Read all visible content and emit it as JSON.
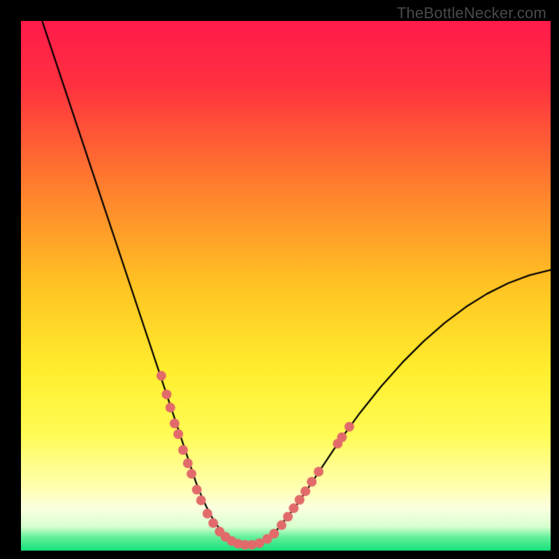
{
  "watermark": "TheBottleNecker.com",
  "chart_data": {
    "type": "line",
    "title": "",
    "xlabel": "",
    "ylabel": "",
    "xlim": [
      0,
      100
    ],
    "ylim": [
      0,
      100
    ],
    "background_gradient": [
      {
        "stop": 0.0,
        "color": "#ff1b4b"
      },
      {
        "stop": 0.12,
        "color": "#ff3140"
      },
      {
        "stop": 0.3,
        "color": "#ff7a2f"
      },
      {
        "stop": 0.5,
        "color": "#ffc423"
      },
      {
        "stop": 0.66,
        "color": "#ffee2e"
      },
      {
        "stop": 0.78,
        "color": "#fffc55"
      },
      {
        "stop": 0.88,
        "color": "#ffffb0"
      },
      {
        "stop": 0.92,
        "color": "#fbffe0"
      },
      {
        "stop": 0.955,
        "color": "#d7ffcf"
      },
      {
        "stop": 0.975,
        "color": "#62f09a"
      },
      {
        "stop": 1.0,
        "color": "#17e07c"
      }
    ],
    "series": [
      {
        "name": "bottleneck-curve",
        "color": "#000000",
        "width": 2.3,
        "x": [
          4,
          6,
          8,
          10,
          12,
          14,
          16,
          18,
          20,
          22,
          24,
          26,
          28,
          30,
          32,
          33,
          34,
          35,
          36,
          37,
          38,
          39,
          40,
          41,
          42,
          43,
          45,
          48,
          52,
          56,
          60,
          64,
          68,
          72,
          76,
          80,
          84,
          88,
          92,
          96,
          100
        ],
        "y": [
          100,
          94,
          88,
          82,
          76,
          70,
          64,
          58,
          52,
          46,
          40,
          34,
          28,
          22,
          16,
          13,
          10.5,
          8.3,
          6.4,
          4.8,
          3.5,
          2.5,
          1.8,
          1.3,
          1.0,
          1.0,
          1.3,
          3.5,
          8.5,
          14.5,
          20.5,
          26.0,
          31.0,
          35.5,
          39.5,
          43.0,
          46.0,
          48.5,
          50.5,
          52.0,
          53.0
        ]
      }
    ],
    "scatter": [
      {
        "name": "sample-points-left",
        "color": "#e26a6a",
        "radius": 7,
        "points": [
          {
            "x": 26.5,
            "y": 33.0
          },
          {
            "x": 27.5,
            "y": 29.5
          },
          {
            "x": 28.2,
            "y": 27.0
          },
          {
            "x": 29.0,
            "y": 24.0
          },
          {
            "x": 29.7,
            "y": 22.0
          },
          {
            "x": 30.6,
            "y": 19.0
          },
          {
            "x": 31.5,
            "y": 16.5
          },
          {
            "x": 32.2,
            "y": 14.5
          },
          {
            "x": 33.2,
            "y": 11.5
          },
          {
            "x": 34.0,
            "y": 9.5
          },
          {
            "x": 35.2,
            "y": 7.0
          },
          {
            "x": 36.3,
            "y": 5.2
          }
        ]
      },
      {
        "name": "sample-points-bottom",
        "color": "#e26a6a",
        "radius": 7,
        "points": [
          {
            "x": 37.5,
            "y": 3.6
          },
          {
            "x": 38.6,
            "y": 2.6
          },
          {
            "x": 39.8,
            "y": 1.8
          },
          {
            "x": 41.0,
            "y": 1.3
          },
          {
            "x": 42.3,
            "y": 1.1
          },
          {
            "x": 43.6,
            "y": 1.1
          },
          {
            "x": 45.0,
            "y": 1.4
          },
          {
            "x": 46.5,
            "y": 2.2
          },
          {
            "x": 47.8,
            "y": 3.2
          }
        ]
      },
      {
        "name": "sample-points-right",
        "color": "#e26a6a",
        "radius": 7,
        "points": [
          {
            "x": 49.2,
            "y": 4.8
          },
          {
            "x": 50.4,
            "y": 6.4
          },
          {
            "x": 51.5,
            "y": 8.0
          },
          {
            "x": 52.6,
            "y": 9.6
          },
          {
            "x": 53.7,
            "y": 11.2
          },
          {
            "x": 54.9,
            "y": 13.0
          },
          {
            "x": 56.2,
            "y": 14.9
          },
          {
            "x": 59.8,
            "y": 20.2
          },
          {
            "x": 60.6,
            "y": 21.4
          },
          {
            "x": 62.0,
            "y": 23.4
          }
        ]
      }
    ]
  }
}
